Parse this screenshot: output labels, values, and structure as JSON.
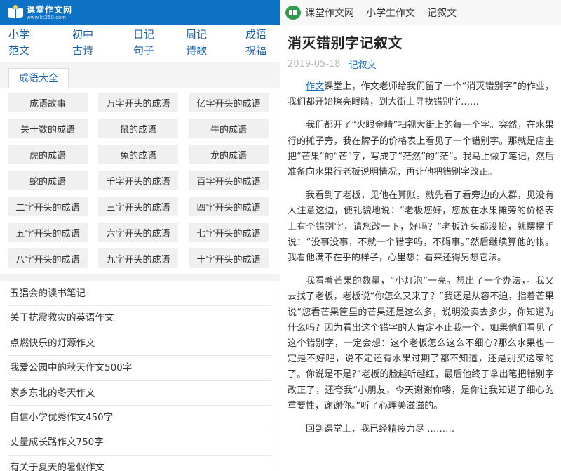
{
  "site": {
    "name": "课堂作文网",
    "url": "www.kt250.com"
  },
  "categories": [
    "小学",
    "初中",
    "日记",
    "周记",
    "成语",
    "范文",
    "古诗",
    "句子",
    "诗歌",
    "祝福"
  ],
  "tab": {
    "label": "成语大全"
  },
  "idioms": [
    "成语故事",
    "万字开头的成语",
    "亿字开头的成语",
    "关于数的成语",
    "鼠的成语",
    "牛的成语",
    "虎的成语",
    "兔的成语",
    "龙的成语",
    "蛇的成语",
    "千字开头的成语",
    "百字开头的成语",
    "二字开头的成语",
    "三字开头的成语",
    "四字开头的成语",
    "五字开头的成语",
    "六字开头的成语",
    "七字开头的成语",
    "八字开头的成语",
    "九字开头的成语",
    "十字开头的成语"
  ],
  "articles": [
    "五猖会的读书笔记",
    "关于抗震救灾的英语作文",
    "点燃快乐的灯源作文",
    "我爱公园中的秋天作文500字",
    "家乡东北的冬天作文",
    "自信小学优秀作文450字",
    "丈量成长路作文750字",
    "有关于夏天的暑假作文"
  ],
  "breadcrumb": {
    "home": "课堂作文网",
    "level1": "小学生作文",
    "level2": "记叙文"
  },
  "article": {
    "title": "消灭错别字记叙文",
    "date": "2019-05-18",
    "category": "记叙文",
    "p1_keyword": "作文",
    "p1_rest": "课堂上，作文老师给我们留了一个“消灭错别字”的作业，我们都开始擦亮眼睛，到大街上寻找错别字……",
    "p2": "我们都开了“火眼金睛”扫视大街上的每一个字。突然，在水果行的摊子旁，我在牌子的价格表上看见了一个错别字。那就是店主把“芒果”的“芒”字，写成了“茫然”的“茫”。我马上做了笔记，然后准备向水果行老板说明情况，再让他把错别字改正。",
    "p3": "我看到了老板，见他在算账。就先看了看旁边的人群，见没有人注意这边，便礼貌地说：“老板您好，您放在水果摊旁的价格表上有个错别字，请您改一下，好吗？”老板连头都没抬，就摆摆手说：“没事没事，不就一个错字吗，不碍事。”然后继续算他的帐。我看他满不在乎的样子，心里想：看来还得另想它法。",
    "p4": "我看着芒果的数量，“小灯泡”一亮。想出了一个办法，。我又去找了老板，老板说“你怎么又来了？”我还是从容不迫，指着芒果说“您看芒果筐里的芒果还是这么多，说明没卖去多少，你知道为什么吗？因为看出这个错字的人肯定不止我一个，如果他们看见了这个错别字，一定会想：这个老板怎么这么不细心?那么水果也一定是不好吧，说不定还有水果过期了都不知道，还是别买这家的了。你说是不是?”老板的脸越听越红，最后他终于拿出笔把错别字改正了，还夸我“小朋友，今天谢谢你喽，是你让我知道了细心的重要性，谢谢你。”听了心理美滋滋的。",
    "p5": "回到课堂上，我已经精疲力尽 ………"
  },
  "colors": {
    "header_blue": "#0e72c4",
    "link_blue": "#1b6fbd",
    "tile_gray": "#f0f0f0",
    "logo_green": "#2f9a4a"
  }
}
